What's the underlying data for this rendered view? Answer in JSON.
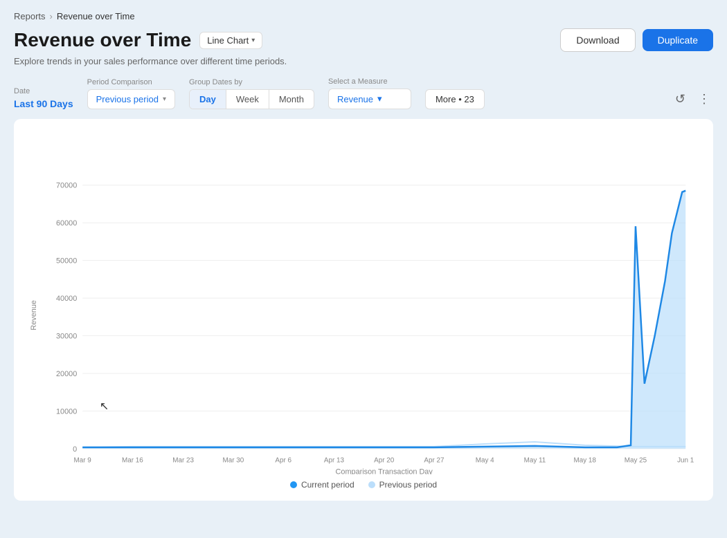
{
  "breadcrumb": {
    "parent": "Reports",
    "separator": "›",
    "current": "Revenue over Time"
  },
  "page": {
    "title": "Revenue over Time",
    "subtitle": "Explore trends in your sales performance over different time periods.",
    "chart_type_label": "Line Chart",
    "download_label": "Download",
    "duplicate_label": "Duplicate"
  },
  "filters": {
    "date_label": "Date",
    "date_value": "Last 90 Days",
    "period_label": "Period Comparison",
    "period_value": "Previous period",
    "group_label": "Group Dates by",
    "group_options": [
      "Day",
      "Week",
      "Month"
    ],
    "group_active": "Day",
    "measure_label": "Select a Measure",
    "measure_value": "Revenue",
    "more_label": "More • 23"
  },
  "chart": {
    "y_axis_label": "Revenue",
    "x_axis_label": "Comparison Transaction Day",
    "y_ticks": [
      "0",
      "10000",
      "20000",
      "30000",
      "40000",
      "50000",
      "60000",
      "70000"
    ],
    "x_ticks": [
      "Mar 9",
      "Mar 16",
      "Mar 23",
      "Mar 30",
      "Apr 6",
      "Apr 13",
      "Apr 20",
      "Apr 27",
      "May 4",
      "May 11",
      "May 18",
      "May 25",
      "Jun 1"
    ],
    "legend": {
      "current_label": "Current period",
      "previous_label": "Previous period"
    }
  },
  "icons": {
    "chevron_down": "▾",
    "refresh": "↺",
    "more_vert": "⋮"
  }
}
